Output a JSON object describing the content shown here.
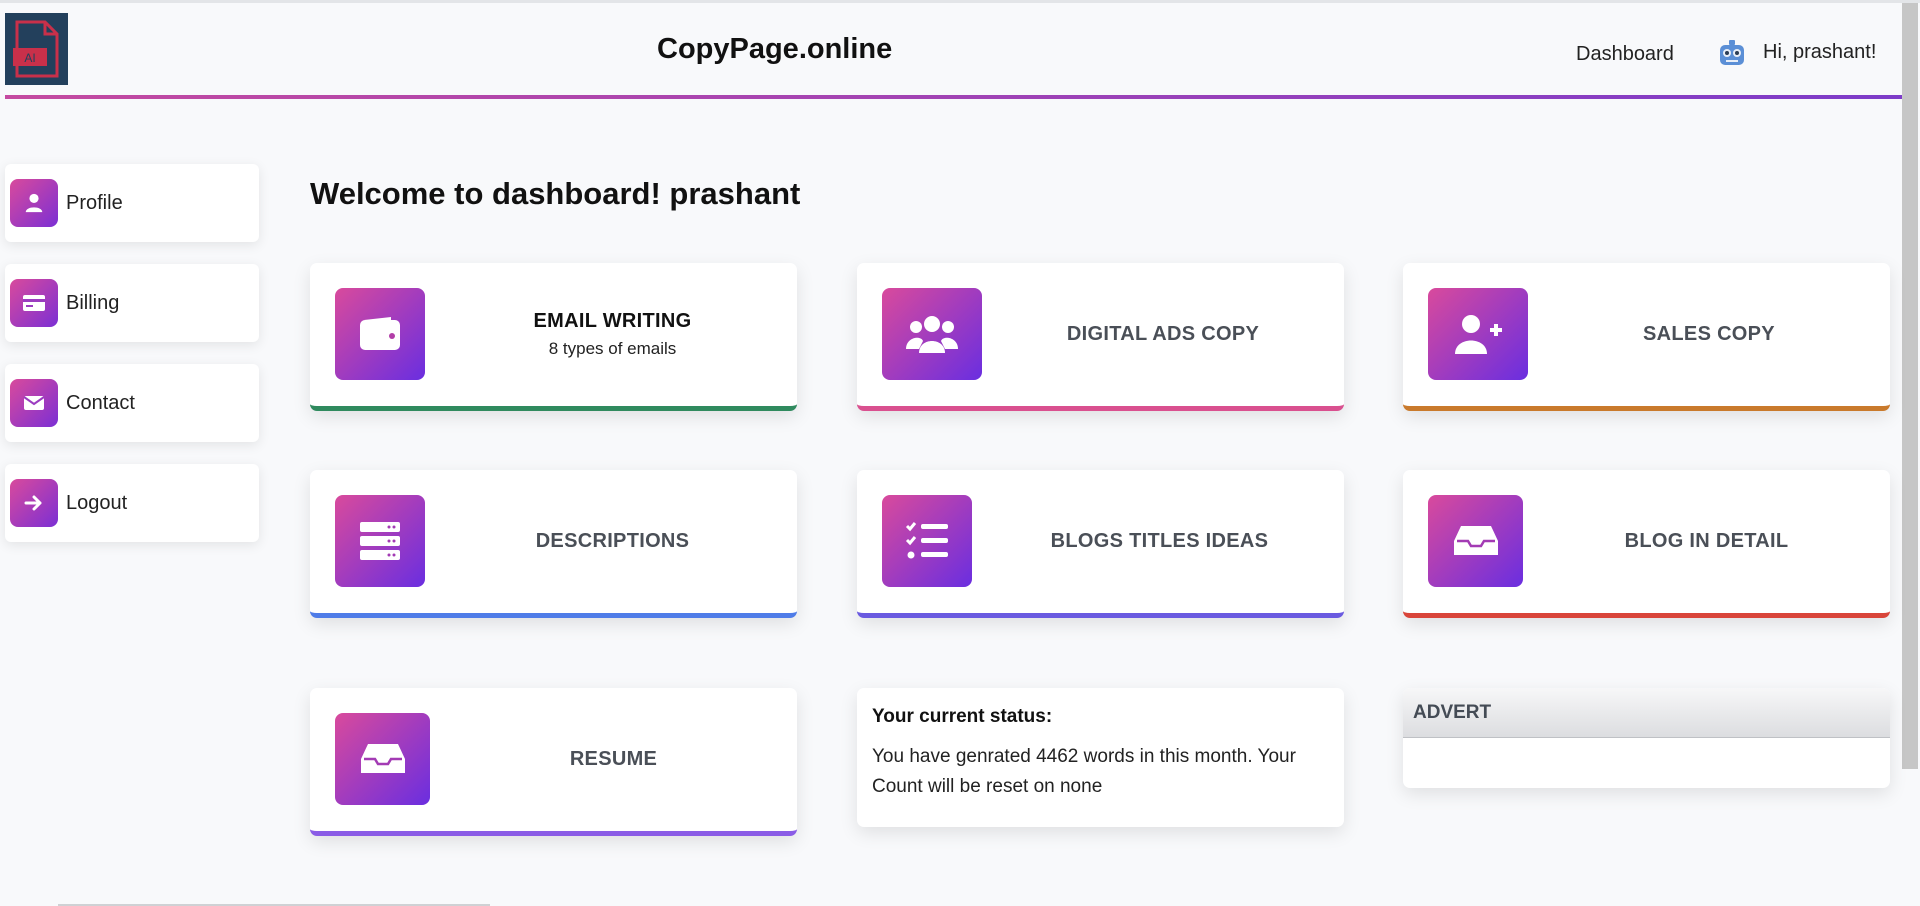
{
  "header": {
    "logo_text": "AI",
    "brand": "CopyPage.online",
    "nav_dashboard": "Dashboard",
    "greeting": "Hi, prashant!"
  },
  "sidebar": {
    "items": [
      {
        "label": "Profile",
        "icon": "user-icon"
      },
      {
        "label": "Billing",
        "icon": "credit-card-icon"
      },
      {
        "label": "Contact",
        "icon": "envelope-icon"
      },
      {
        "label": "Logout",
        "icon": "arrow-right-icon"
      }
    ]
  },
  "main": {
    "welcome": "Welcome to dashboard! prashant",
    "cards": [
      {
        "title": "EMAIL WRITING",
        "subtitle": "8 types of emails",
        "icon": "wallet-icon",
        "accent": "#2f8a5e"
      },
      {
        "title": "DIGITAL ADS COPY",
        "icon": "users-icon",
        "accent": "#d9508f"
      },
      {
        "title": "SALES COPY",
        "icon": "user-plus-icon",
        "accent": "#c97a2c"
      },
      {
        "title": "DESCRIPTIONS",
        "icon": "server-icon",
        "accent": "#4f7ce8"
      },
      {
        "title": "BLOGS TITLES IDEAS",
        "icon": "list-check-icon",
        "accent": "#6a5ae0"
      },
      {
        "title": "BLOG IN DETAIL",
        "icon": "inbox-icon",
        "accent": "#d9453a"
      },
      {
        "title": "RESUME",
        "icon": "inbox-icon",
        "accent": "#8a5ce6"
      }
    ],
    "status": {
      "title": "Your current status:",
      "text": "You have genrated 4462 words in this month. Your Count will be reset on none"
    },
    "advert": {
      "title": "ADVERT"
    }
  },
  "colors": {
    "gradient_start": "#d94a9c",
    "gradient_end": "#6a2ee0",
    "header_line_start": "#c44aa0",
    "header_line_end": "#7d3cc9"
  }
}
